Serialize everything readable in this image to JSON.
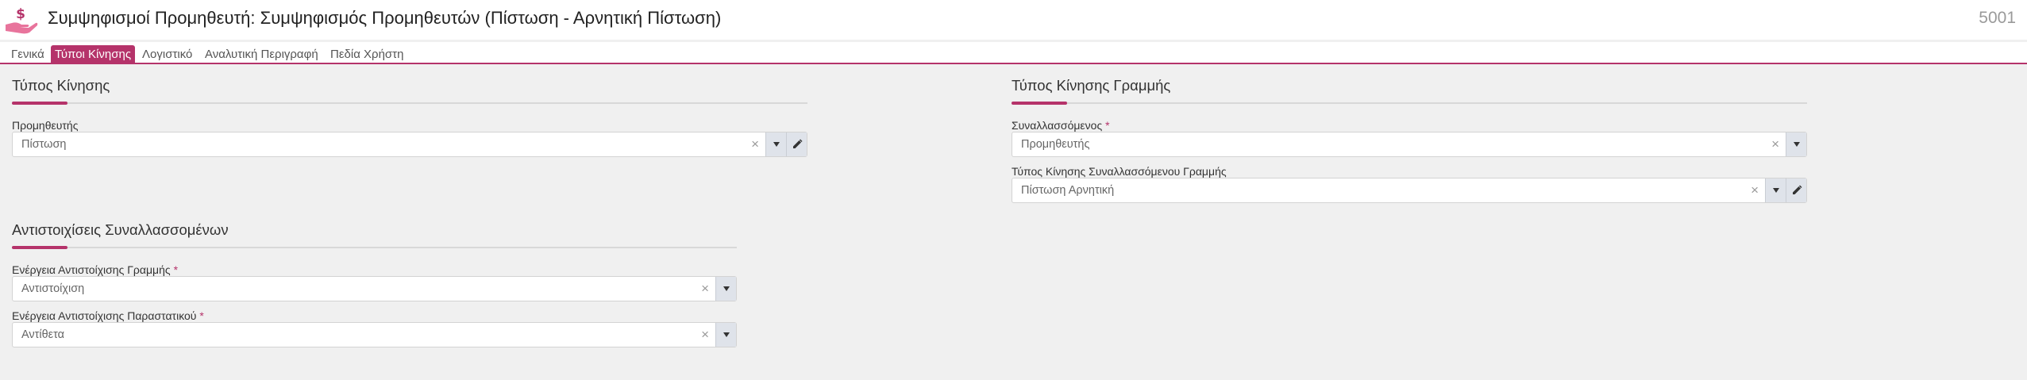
{
  "header": {
    "title": "Συμψηφισμοί Προμηθευτή: Συμψηφισμός Προμηθευτών (Πίστωση - Αρνητική Πίστωση)",
    "record_number": "5001",
    "logo_icon": "hand-dollar-icon"
  },
  "tabs": [
    {
      "label": "Γενικά",
      "active": false
    },
    {
      "label": "Τύποι Κίνησης",
      "active": true
    },
    {
      "label": "Λογιστικό",
      "active": false
    },
    {
      "label": "Αναλυτική Περιγραφή",
      "active": false
    },
    {
      "label": "Πεδία Χρήστη",
      "active": false
    }
  ],
  "sections": {
    "movement_type": {
      "title": "Τύπος Κίνησης",
      "supplier": {
        "label": "Προμηθευτής",
        "value": "Πίστωση"
      }
    },
    "line_movement_type": {
      "title": "Τύπος Κίνησης Γραμμής",
      "counterparty": {
        "label": "Συναλλασσόμενος",
        "required_mark": "*",
        "value": "Προμηθευτής"
      },
      "counterparty_line_type": {
        "label": "Τύπος Κίνησης Συναλλασσόμενου Γραμμής",
        "value": "Πίστωση Αρνητική"
      }
    },
    "counterparty_matching": {
      "title": "Αντιστοιχίσεις Συναλλασσομένων",
      "line_action": {
        "label": "Ενέργεια Αντιστοίχισης Γραμμής",
        "required_mark": "*",
        "value": "Αντιστοίχιση"
      },
      "document_action": {
        "label": "Ενέργεια Αντιστοίχισης Παραστατικού",
        "required_mark": "*",
        "value": "Αντίθετα"
      }
    }
  },
  "icons": {
    "clear": "×",
    "dropdown": "chevron-down-icon",
    "edit": "pencil-icon"
  },
  "colors": {
    "accent": "#b5336a",
    "logo": "#e8749c"
  }
}
